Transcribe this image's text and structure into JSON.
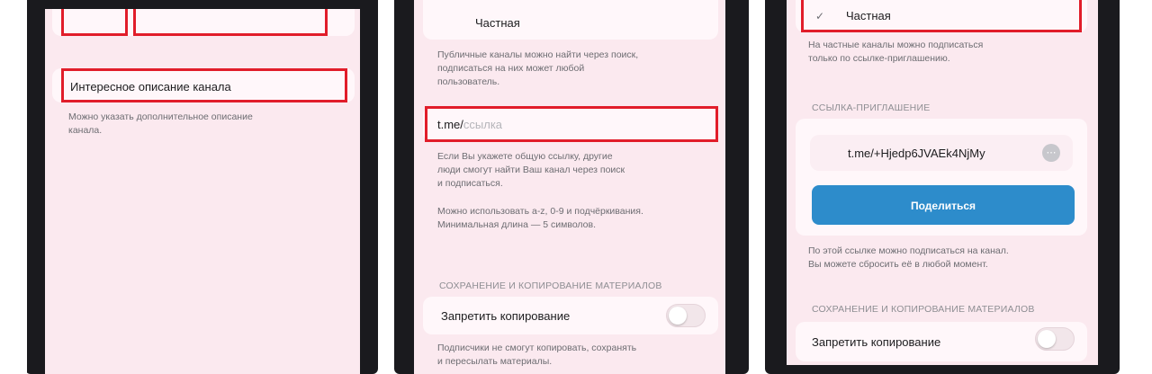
{
  "screen1": {
    "title_field_value": "Интересное описание канала",
    "description_hint": "Можно указать дополнительное описание\nканала."
  },
  "screen2": {
    "type_option": "Частная",
    "type_hint": "Публичные каналы можно найти через поиск,\nподписаться на них может любой\nпользователь.",
    "link_prefix": "t.me/",
    "link_placeholder": "ссылка",
    "link_hint_1": "Если Вы укажете общую ссылку, другие\nлюди смогут найти Ваш канал через поиск\nи подписаться.",
    "link_hint_2": "Можно использовать a-z, 0-9 и подчёркивания.\nМинимальная длина — 5 символов.",
    "section_copy": "СОХРАНЕНИЕ И КОПИРОВАНИЕ МАТЕРИАЛОВ",
    "restrict_label": "Запретить копирование",
    "restrict_hint": "Подписчики не смогут копировать, сохранять\nи пересылать материалы."
  },
  "screen3": {
    "check_mark": "✓",
    "type_option": "Частная",
    "type_hint": "На частные каналы можно подписаться\nтолько по ссылке-приглашению.",
    "section_link": "ССЫЛКА-ПРИГЛАШЕНИЕ",
    "invite_link": "t.me/+Hjedp6JVAEk4NjMy",
    "share_button": "Поделиться",
    "share_hint": "По этой ссылке можно подписаться на канал.\nВы можете сбросить её в любой момент.",
    "section_copy": "СОХРАНЕНИЕ И КОПИРОВАНИЕ МАТЕРИАЛОВ",
    "restrict_label": "Запретить копирование"
  },
  "colors": {
    "highlight": "#e11d2a",
    "accent": "#2d8ccb",
    "background": "#fbe9ef"
  }
}
